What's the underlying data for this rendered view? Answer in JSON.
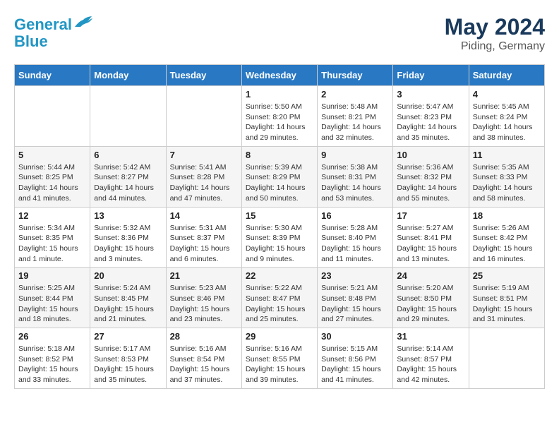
{
  "header": {
    "logo_line1": "General",
    "logo_line2": "Blue",
    "title": "May 2024",
    "location": "Piding, Germany"
  },
  "days_of_week": [
    "Sunday",
    "Monday",
    "Tuesday",
    "Wednesday",
    "Thursday",
    "Friday",
    "Saturday"
  ],
  "weeks": [
    {
      "days": [
        {
          "num": "",
          "info": ""
        },
        {
          "num": "",
          "info": ""
        },
        {
          "num": "",
          "info": ""
        },
        {
          "num": "1",
          "info": "Sunrise: 5:50 AM\nSunset: 8:20 PM\nDaylight: 14 hours and 29 minutes."
        },
        {
          "num": "2",
          "info": "Sunrise: 5:48 AM\nSunset: 8:21 PM\nDaylight: 14 hours and 32 minutes."
        },
        {
          "num": "3",
          "info": "Sunrise: 5:47 AM\nSunset: 8:23 PM\nDaylight: 14 hours and 35 minutes."
        },
        {
          "num": "4",
          "info": "Sunrise: 5:45 AM\nSunset: 8:24 PM\nDaylight: 14 hours and 38 minutes."
        }
      ]
    },
    {
      "days": [
        {
          "num": "5",
          "info": "Sunrise: 5:44 AM\nSunset: 8:25 PM\nDaylight: 14 hours and 41 minutes."
        },
        {
          "num": "6",
          "info": "Sunrise: 5:42 AM\nSunset: 8:27 PM\nDaylight: 14 hours and 44 minutes."
        },
        {
          "num": "7",
          "info": "Sunrise: 5:41 AM\nSunset: 8:28 PM\nDaylight: 14 hours and 47 minutes."
        },
        {
          "num": "8",
          "info": "Sunrise: 5:39 AM\nSunset: 8:29 PM\nDaylight: 14 hours and 50 minutes."
        },
        {
          "num": "9",
          "info": "Sunrise: 5:38 AM\nSunset: 8:31 PM\nDaylight: 14 hours and 53 minutes."
        },
        {
          "num": "10",
          "info": "Sunrise: 5:36 AM\nSunset: 8:32 PM\nDaylight: 14 hours and 55 minutes."
        },
        {
          "num": "11",
          "info": "Sunrise: 5:35 AM\nSunset: 8:33 PM\nDaylight: 14 hours and 58 minutes."
        }
      ]
    },
    {
      "days": [
        {
          "num": "12",
          "info": "Sunrise: 5:34 AM\nSunset: 8:35 PM\nDaylight: 15 hours and 1 minute."
        },
        {
          "num": "13",
          "info": "Sunrise: 5:32 AM\nSunset: 8:36 PM\nDaylight: 15 hours and 3 minutes."
        },
        {
          "num": "14",
          "info": "Sunrise: 5:31 AM\nSunset: 8:37 PM\nDaylight: 15 hours and 6 minutes."
        },
        {
          "num": "15",
          "info": "Sunrise: 5:30 AM\nSunset: 8:39 PM\nDaylight: 15 hours and 9 minutes."
        },
        {
          "num": "16",
          "info": "Sunrise: 5:28 AM\nSunset: 8:40 PM\nDaylight: 15 hours and 11 minutes."
        },
        {
          "num": "17",
          "info": "Sunrise: 5:27 AM\nSunset: 8:41 PM\nDaylight: 15 hours and 13 minutes."
        },
        {
          "num": "18",
          "info": "Sunrise: 5:26 AM\nSunset: 8:42 PM\nDaylight: 15 hours and 16 minutes."
        }
      ]
    },
    {
      "days": [
        {
          "num": "19",
          "info": "Sunrise: 5:25 AM\nSunset: 8:44 PM\nDaylight: 15 hours and 18 minutes."
        },
        {
          "num": "20",
          "info": "Sunrise: 5:24 AM\nSunset: 8:45 PM\nDaylight: 15 hours and 21 minutes."
        },
        {
          "num": "21",
          "info": "Sunrise: 5:23 AM\nSunset: 8:46 PM\nDaylight: 15 hours and 23 minutes."
        },
        {
          "num": "22",
          "info": "Sunrise: 5:22 AM\nSunset: 8:47 PM\nDaylight: 15 hours and 25 minutes."
        },
        {
          "num": "23",
          "info": "Sunrise: 5:21 AM\nSunset: 8:48 PM\nDaylight: 15 hours and 27 minutes."
        },
        {
          "num": "24",
          "info": "Sunrise: 5:20 AM\nSunset: 8:50 PM\nDaylight: 15 hours and 29 minutes."
        },
        {
          "num": "25",
          "info": "Sunrise: 5:19 AM\nSunset: 8:51 PM\nDaylight: 15 hours and 31 minutes."
        }
      ]
    },
    {
      "days": [
        {
          "num": "26",
          "info": "Sunrise: 5:18 AM\nSunset: 8:52 PM\nDaylight: 15 hours and 33 minutes."
        },
        {
          "num": "27",
          "info": "Sunrise: 5:17 AM\nSunset: 8:53 PM\nDaylight: 15 hours and 35 minutes."
        },
        {
          "num": "28",
          "info": "Sunrise: 5:16 AM\nSunset: 8:54 PM\nDaylight: 15 hours and 37 minutes."
        },
        {
          "num": "29",
          "info": "Sunrise: 5:16 AM\nSunset: 8:55 PM\nDaylight: 15 hours and 39 minutes."
        },
        {
          "num": "30",
          "info": "Sunrise: 5:15 AM\nSunset: 8:56 PM\nDaylight: 15 hours and 41 minutes."
        },
        {
          "num": "31",
          "info": "Sunrise: 5:14 AM\nSunset: 8:57 PM\nDaylight: 15 hours and 42 minutes."
        },
        {
          "num": "",
          "info": ""
        }
      ]
    }
  ]
}
